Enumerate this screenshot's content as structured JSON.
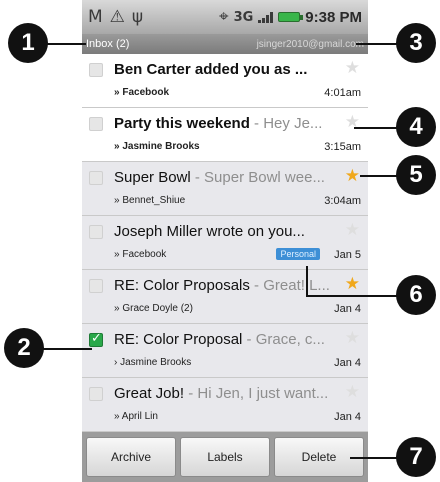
{
  "status_bar": {
    "icons": [
      "gmail-icon",
      "warning-icon",
      "usb-icon",
      "gps-icon",
      "network-3g-icon",
      "signal-icon",
      "battery-icon"
    ],
    "network_label": "3G",
    "time": "9:38 PM"
  },
  "header": {
    "folder": "Inbox (2)",
    "account": "jsinger2010@gmail.com"
  },
  "emails": [
    {
      "subject": "Ben Carter added you as ...",
      "snippet": "",
      "sender": "» Facebook",
      "time": "4:01am",
      "unread": true,
      "starred": false,
      "checked": false,
      "label": ""
    },
    {
      "subject": "Party this weekend",
      "snippet": " - Hey Je...",
      "sender": "» Jasmine Brooks",
      "time": "3:15am",
      "unread": true,
      "starred": false,
      "checked": false,
      "label": ""
    },
    {
      "subject": "Super Bowl",
      "snippet": " - Super Bowl wee...",
      "sender": "» Bennet_Shiue",
      "time": "3:04am",
      "unread": false,
      "starred": true,
      "checked": false,
      "label": ""
    },
    {
      "subject": "Joseph Miller wrote on you...",
      "snippet": "",
      "sender": "» Facebook",
      "time": "Jan 5",
      "unread": false,
      "starred": false,
      "checked": false,
      "label": "Personal"
    },
    {
      "subject": "RE: Color Proposals",
      "snippet": " - Great! L...",
      "sender": "» Grace Doyle (2)",
      "time": "Jan 4",
      "unread": false,
      "starred": true,
      "checked": false,
      "label": ""
    },
    {
      "subject": "RE: Color Proposal",
      "snippet": " - Grace, c...",
      "sender": "› Jasmine Brooks",
      "time": "Jan 4",
      "unread": false,
      "starred": false,
      "checked": true,
      "label": ""
    },
    {
      "subject": "Great Job!",
      "snippet": " - Hi Jen, I just want...",
      "sender": "» April Lin",
      "time": "Jan 4",
      "unread": false,
      "starred": false,
      "checked": false,
      "label": ""
    }
  ],
  "actions": {
    "archive": "Archive",
    "labels": "Labels",
    "delete": "Delete"
  },
  "callouts": [
    "1",
    "2",
    "3",
    "4",
    "5",
    "6",
    "7"
  ],
  "colors": {
    "star_on": "#f0a81c",
    "checkbox_checked": "#2aa84a",
    "label_badge": "#3d8fd6",
    "battery": "#39b54a"
  }
}
